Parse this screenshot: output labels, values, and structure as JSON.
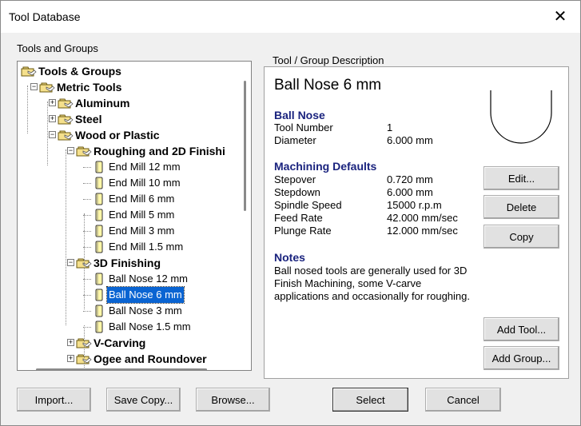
{
  "window": {
    "title": "Tool Database",
    "close_glyph": "✕"
  },
  "left_panel": {
    "label": "Tools and Groups"
  },
  "tree": [
    {
      "label": "Tools & Groups",
      "kind": "group",
      "indent": 0,
      "expander": "none"
    },
    {
      "label": "Metric Tools",
      "kind": "group",
      "indent": 1,
      "expander": "minus"
    },
    {
      "label": "Aluminum",
      "kind": "group",
      "indent": 2,
      "expander": "plus"
    },
    {
      "label": "Steel",
      "kind": "group",
      "indent": 2,
      "expander": "plus"
    },
    {
      "label": "Wood or Plastic",
      "kind": "group",
      "indent": 2,
      "expander": "minus"
    },
    {
      "label": "Roughing and 2D Finishi",
      "kind": "group",
      "indent": 3,
      "expander": "minus"
    },
    {
      "label": "End Mill 12 mm",
      "kind": "tool",
      "indent": 4
    },
    {
      "label": "End Mill 10 mm",
      "kind": "tool",
      "indent": 4
    },
    {
      "label": "End Mill 6 mm",
      "kind": "tool",
      "indent": 4
    },
    {
      "label": "End Mill 5 mm",
      "kind": "tool",
      "indent": 4
    },
    {
      "label": "End Mill 3 mm",
      "kind": "tool",
      "indent": 4
    },
    {
      "label": "End Mill 1.5 mm",
      "kind": "tool",
      "indent": 4
    },
    {
      "label": "3D Finishing",
      "kind": "group",
      "indent": 3,
      "expander": "minus"
    },
    {
      "label": "Ball Nose 12 mm",
      "kind": "tool",
      "indent": 4
    },
    {
      "label": "Ball Nose 6 mm",
      "kind": "tool",
      "indent": 4,
      "selected": true
    },
    {
      "label": "Ball Nose 3 mm",
      "kind": "tool",
      "indent": 4
    },
    {
      "label": "Ball Nose 1.5 mm",
      "kind": "tool",
      "indent": 4
    },
    {
      "label": "V-Carving",
      "kind": "group",
      "indent": 3,
      "expander": "plus"
    },
    {
      "label": "Ogee and Roundover",
      "kind": "group",
      "indent": 3,
      "expander": "plus"
    }
  ],
  "description": {
    "group_label": "Tool / Group Description",
    "title": "Ball Nose 6 mm",
    "tool_header": "Ball Nose",
    "tool_fields": [
      {
        "key": "Tool Number",
        "value": "1"
      },
      {
        "key": "Diameter",
        "value": "6.000 mm"
      }
    ],
    "defaults_header": "Machining Defaults",
    "defaults_fields": [
      {
        "key": "Stepover",
        "value": "0.720 mm"
      },
      {
        "key": "Stepdown",
        "value": "6.000 mm"
      },
      {
        "key": "Spindle Speed",
        "value": "15000 r.p.m"
      },
      {
        "key": "Feed Rate",
        "value": "42.000 mm/sec"
      },
      {
        "key": "Plunge Rate",
        "value": "12.000 mm/sec"
      }
    ],
    "notes_header": "Notes",
    "notes_text": "Ball nosed tools are generally used for 3D Finish Machining, some V-carve applications and occasionally for roughing."
  },
  "buttons": {
    "edit": "Edit...",
    "delete": "Delete",
    "copy": "Copy",
    "add_tool": "Add Tool...",
    "add_group": "Add Group...",
    "import": "Import...",
    "save_copy": "Save Copy...",
    "browse": "Browse...",
    "select": "Select",
    "cancel": "Cancel"
  },
  "colors": {
    "selection": "#0a64d2",
    "header_text": "#1a237e",
    "folder": "#f5e08c",
    "tool": "#fff7a8"
  }
}
